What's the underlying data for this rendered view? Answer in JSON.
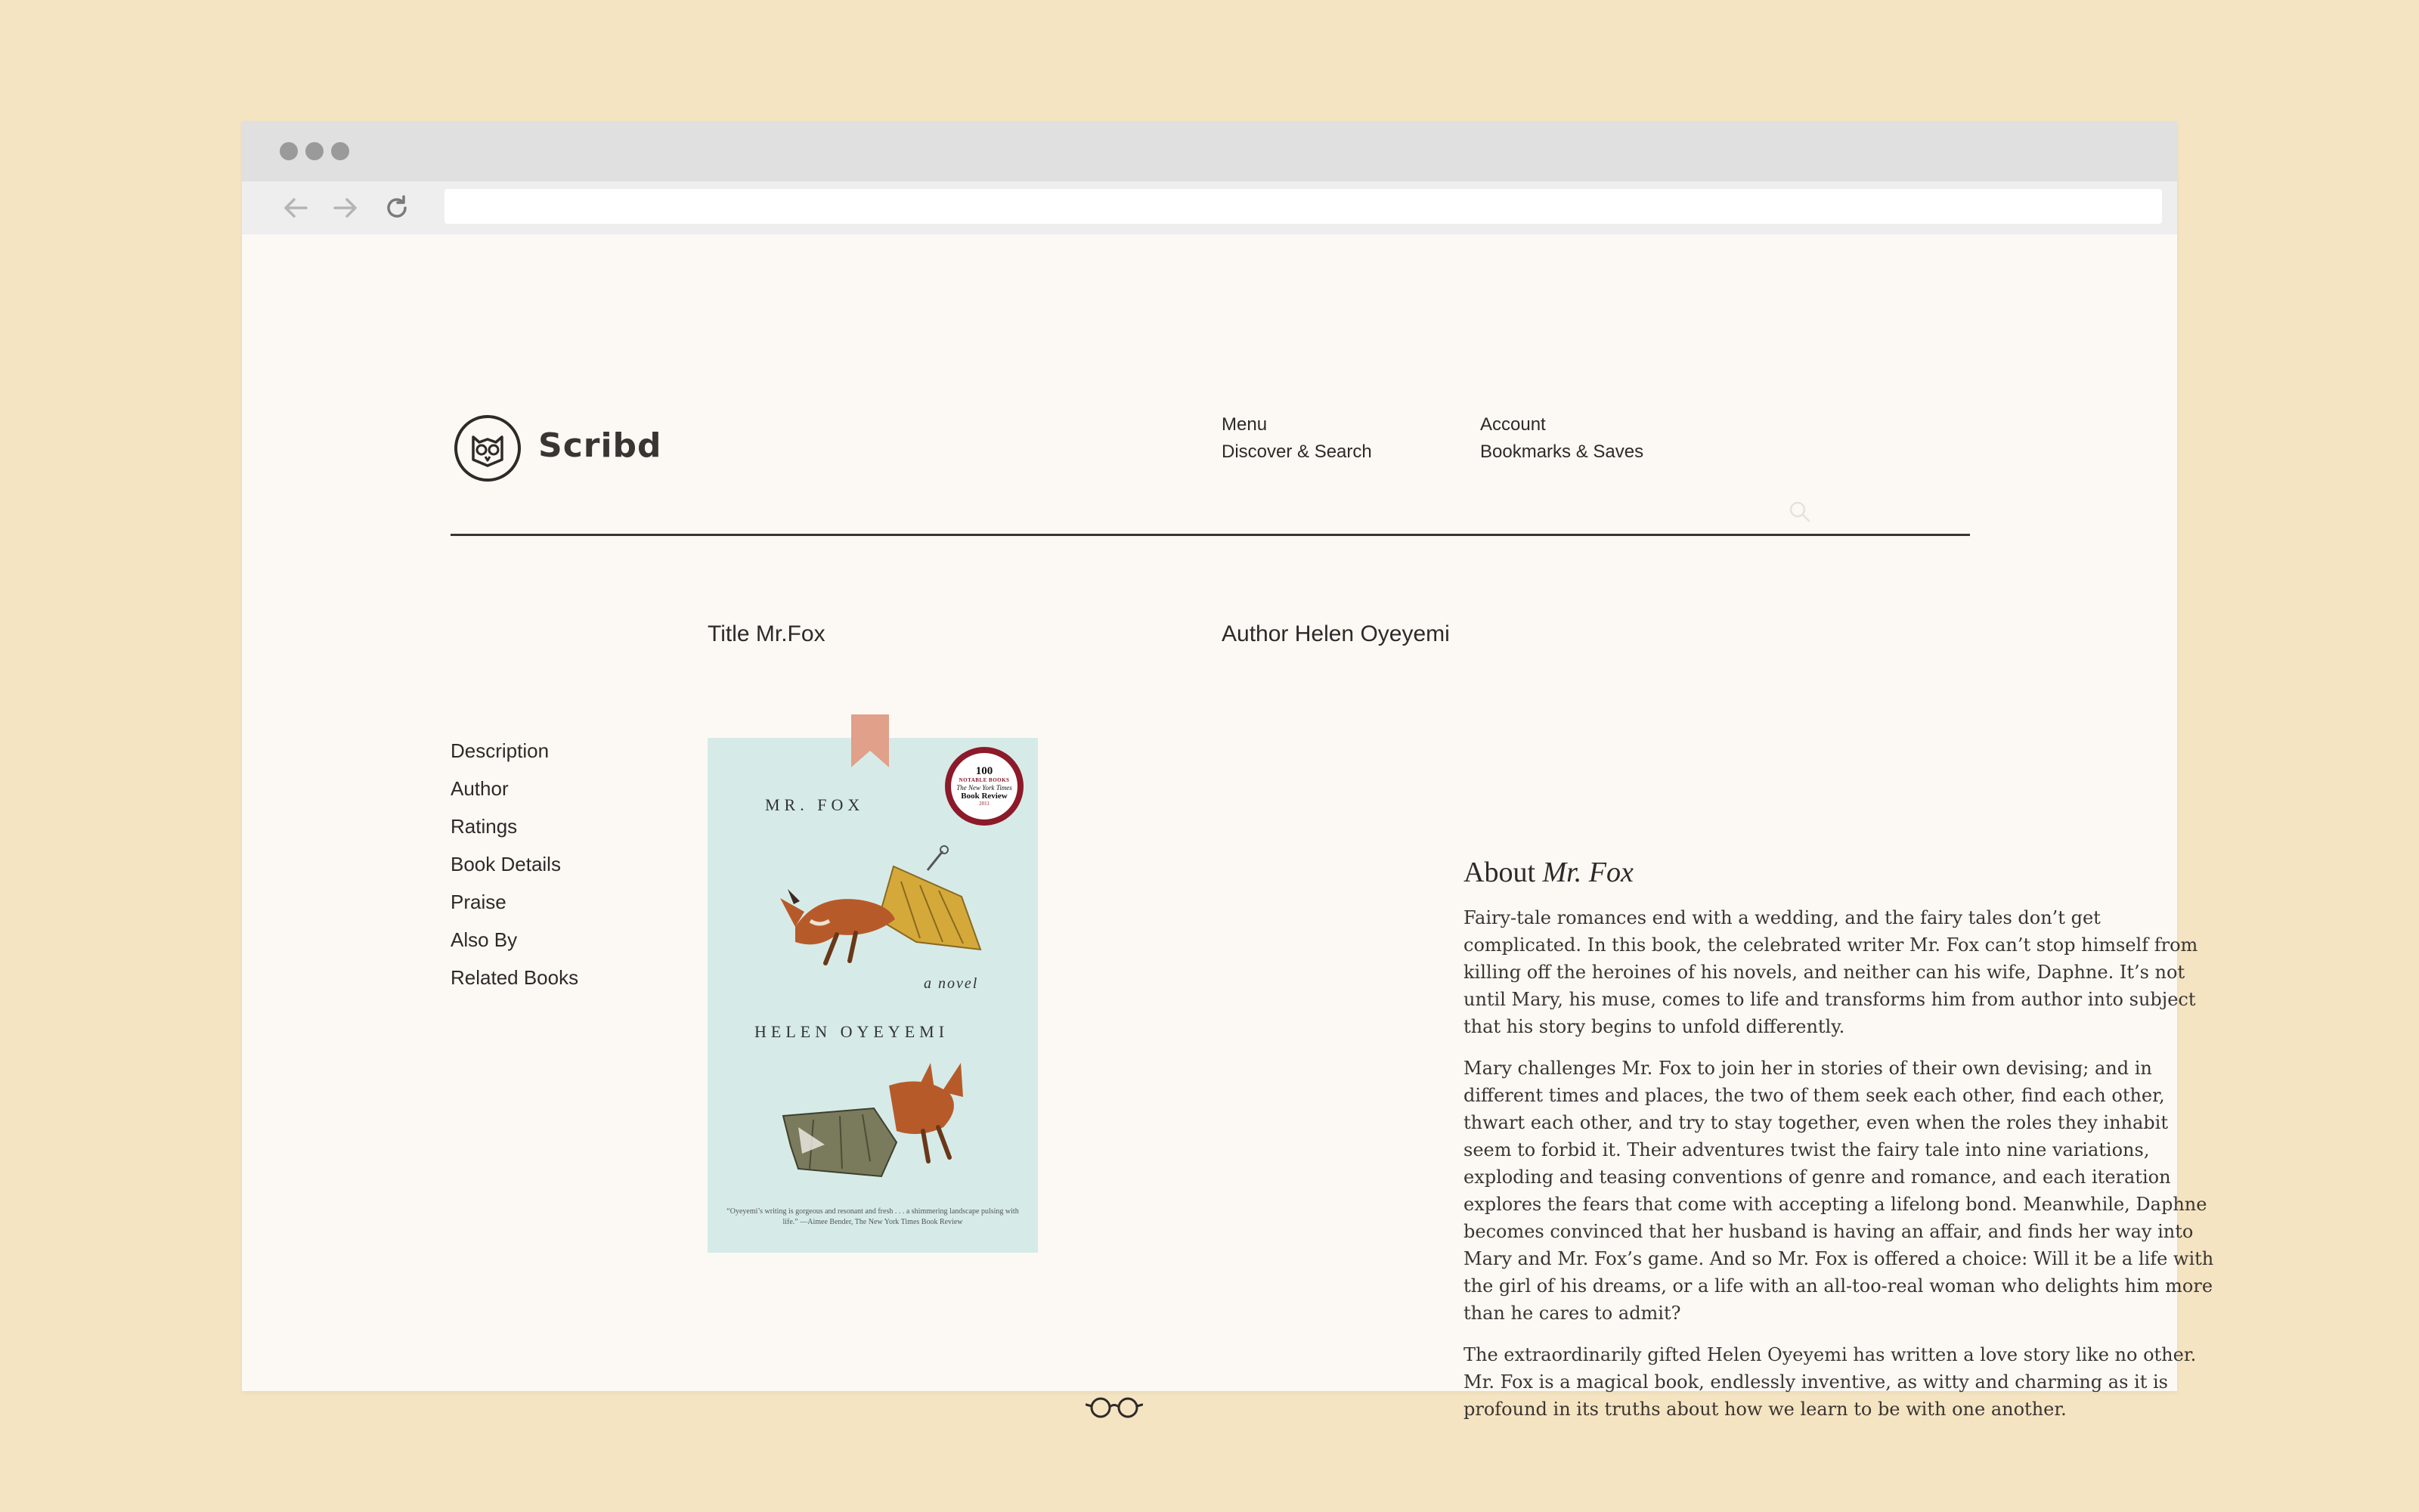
{
  "browser": {
    "url": "",
    "back_icon": "arrow-left-icon",
    "forward_icon": "arrow-right-icon",
    "reload_icon": "reload-icon"
  },
  "header": {
    "brand": "Scribd",
    "logo_icon": "owl-icon",
    "nav_col1": [
      "Menu",
      "Discover & Search"
    ],
    "nav_col2": [
      "Account",
      "Bookmarks & Saves"
    ],
    "search_icon": "search-icon"
  },
  "book": {
    "title_field": "Title Mr.Fox",
    "author_field": "Author Helen Oyeyemi",
    "cover": {
      "title": "MR. FOX",
      "subtitle": "a novel",
      "author": "HELEN OYEYEMI",
      "badge": {
        "number": "100",
        "label": "NOTABLE BOOKS",
        "source": "The New York Times",
        "publication": "Book Review",
        "year": "2011"
      },
      "quote": "“Oyeyemi’s writing is gorgeous and resonant and fresh . . . a shimmering landscape pulsing with life.” —Aimee Bender, The New York Times Book Review"
    }
  },
  "sidenav": {
    "items": [
      "Description",
      "Author",
      "Ratings",
      "Book Details",
      "Praise",
      "Also By",
      "Related Books"
    ]
  },
  "about": {
    "heading_prefix": "About ",
    "heading_title": "Mr. Fox",
    "paragraphs": [
      "Fairy-tale romances end with a wedding, and the fairy tales don’t get complicated. In this book, the celebrated writer Mr. Fox can’t stop himself from killing off the heroines of his novels, and neither can his wife, Daphne. It’s not until Mary, his muse, comes to life and transforms him from author into subject that his story begins to unfold differently.",
      "Mary challenges Mr. Fox to join her in stories of their own devising; and in different times and places, the two of them seek each other, find each other, thwart each other, and try to stay together, even when the roles they inhabit seem to forbid it. Their adventures twist the fairy tale into nine variations, exploding and teasing conventions of genre and romance, and each iteration explores the fears that come with accepting a lifelong bond. Meanwhile, Daphne becomes convinced that her husband is having an affair, and finds her way into Mary and Mr. Fox’s game. And so Mr. Fox is offered a choice: Will it be a life with the girl of his dreams, or a life with an all-too-real woman who delights him more than he cares to admit?",
      "The extraordinarily gifted Helen Oyeyemi has written a love story like no other.  Mr. Fox is a magical book, endlessly inventive, as witty and charming as it is profound in its truths about how we learn to be with one another."
    ]
  },
  "colors": {
    "page_bg": "#f4e4c2",
    "window_bg": "#fcf9f5",
    "text": "#2e2a27",
    "bookmark": "#e0a08a",
    "cover_bg": "#d6ebe8"
  }
}
